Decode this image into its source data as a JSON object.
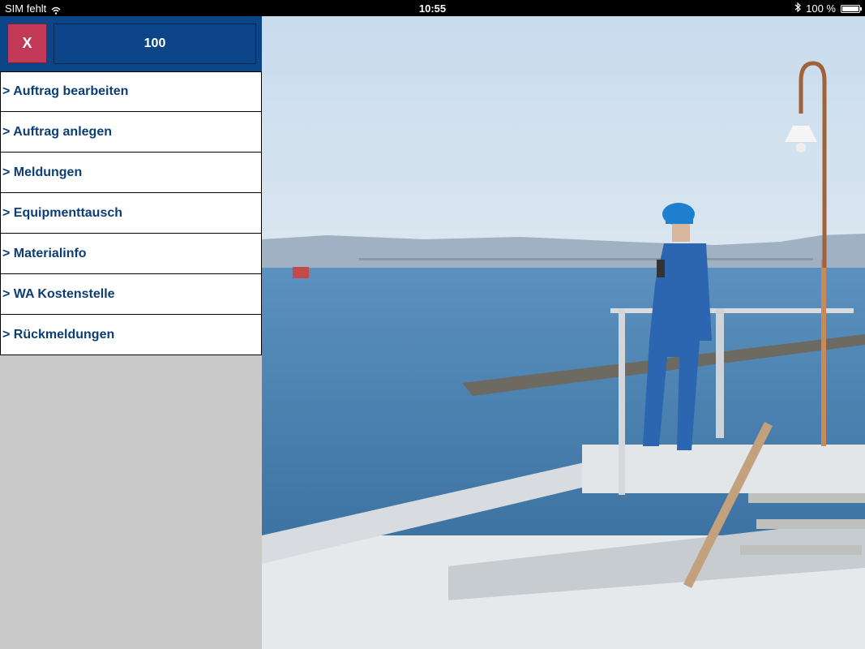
{
  "status_bar": {
    "carrier": "SIM fehlt",
    "time": "10:55",
    "battery": "100 %",
    "battery_level": 1.0,
    "icons": [
      "wifi-icon",
      "bluetooth-icon",
      "battery-icon"
    ]
  },
  "header": {
    "close_label": "X",
    "number_label": "100"
  },
  "menu": {
    "items": [
      {
        "label": "> Auftrag bearbeiten"
      },
      {
        "label": "> Auftrag anlegen"
      },
      {
        "label": "> Meldungen"
      },
      {
        "label": "> Equipmenttausch"
      },
      {
        "label": "> Materialinfo"
      },
      {
        "label": "> WA Kostenstelle"
      },
      {
        "label": "> Rückmeldungen"
      }
    ]
  },
  "colors": {
    "header_blue": "#0c4587",
    "close_red": "#c23a57",
    "menu_text": "#0c3e74",
    "sidebar_bg": "#c9c9c9"
  }
}
